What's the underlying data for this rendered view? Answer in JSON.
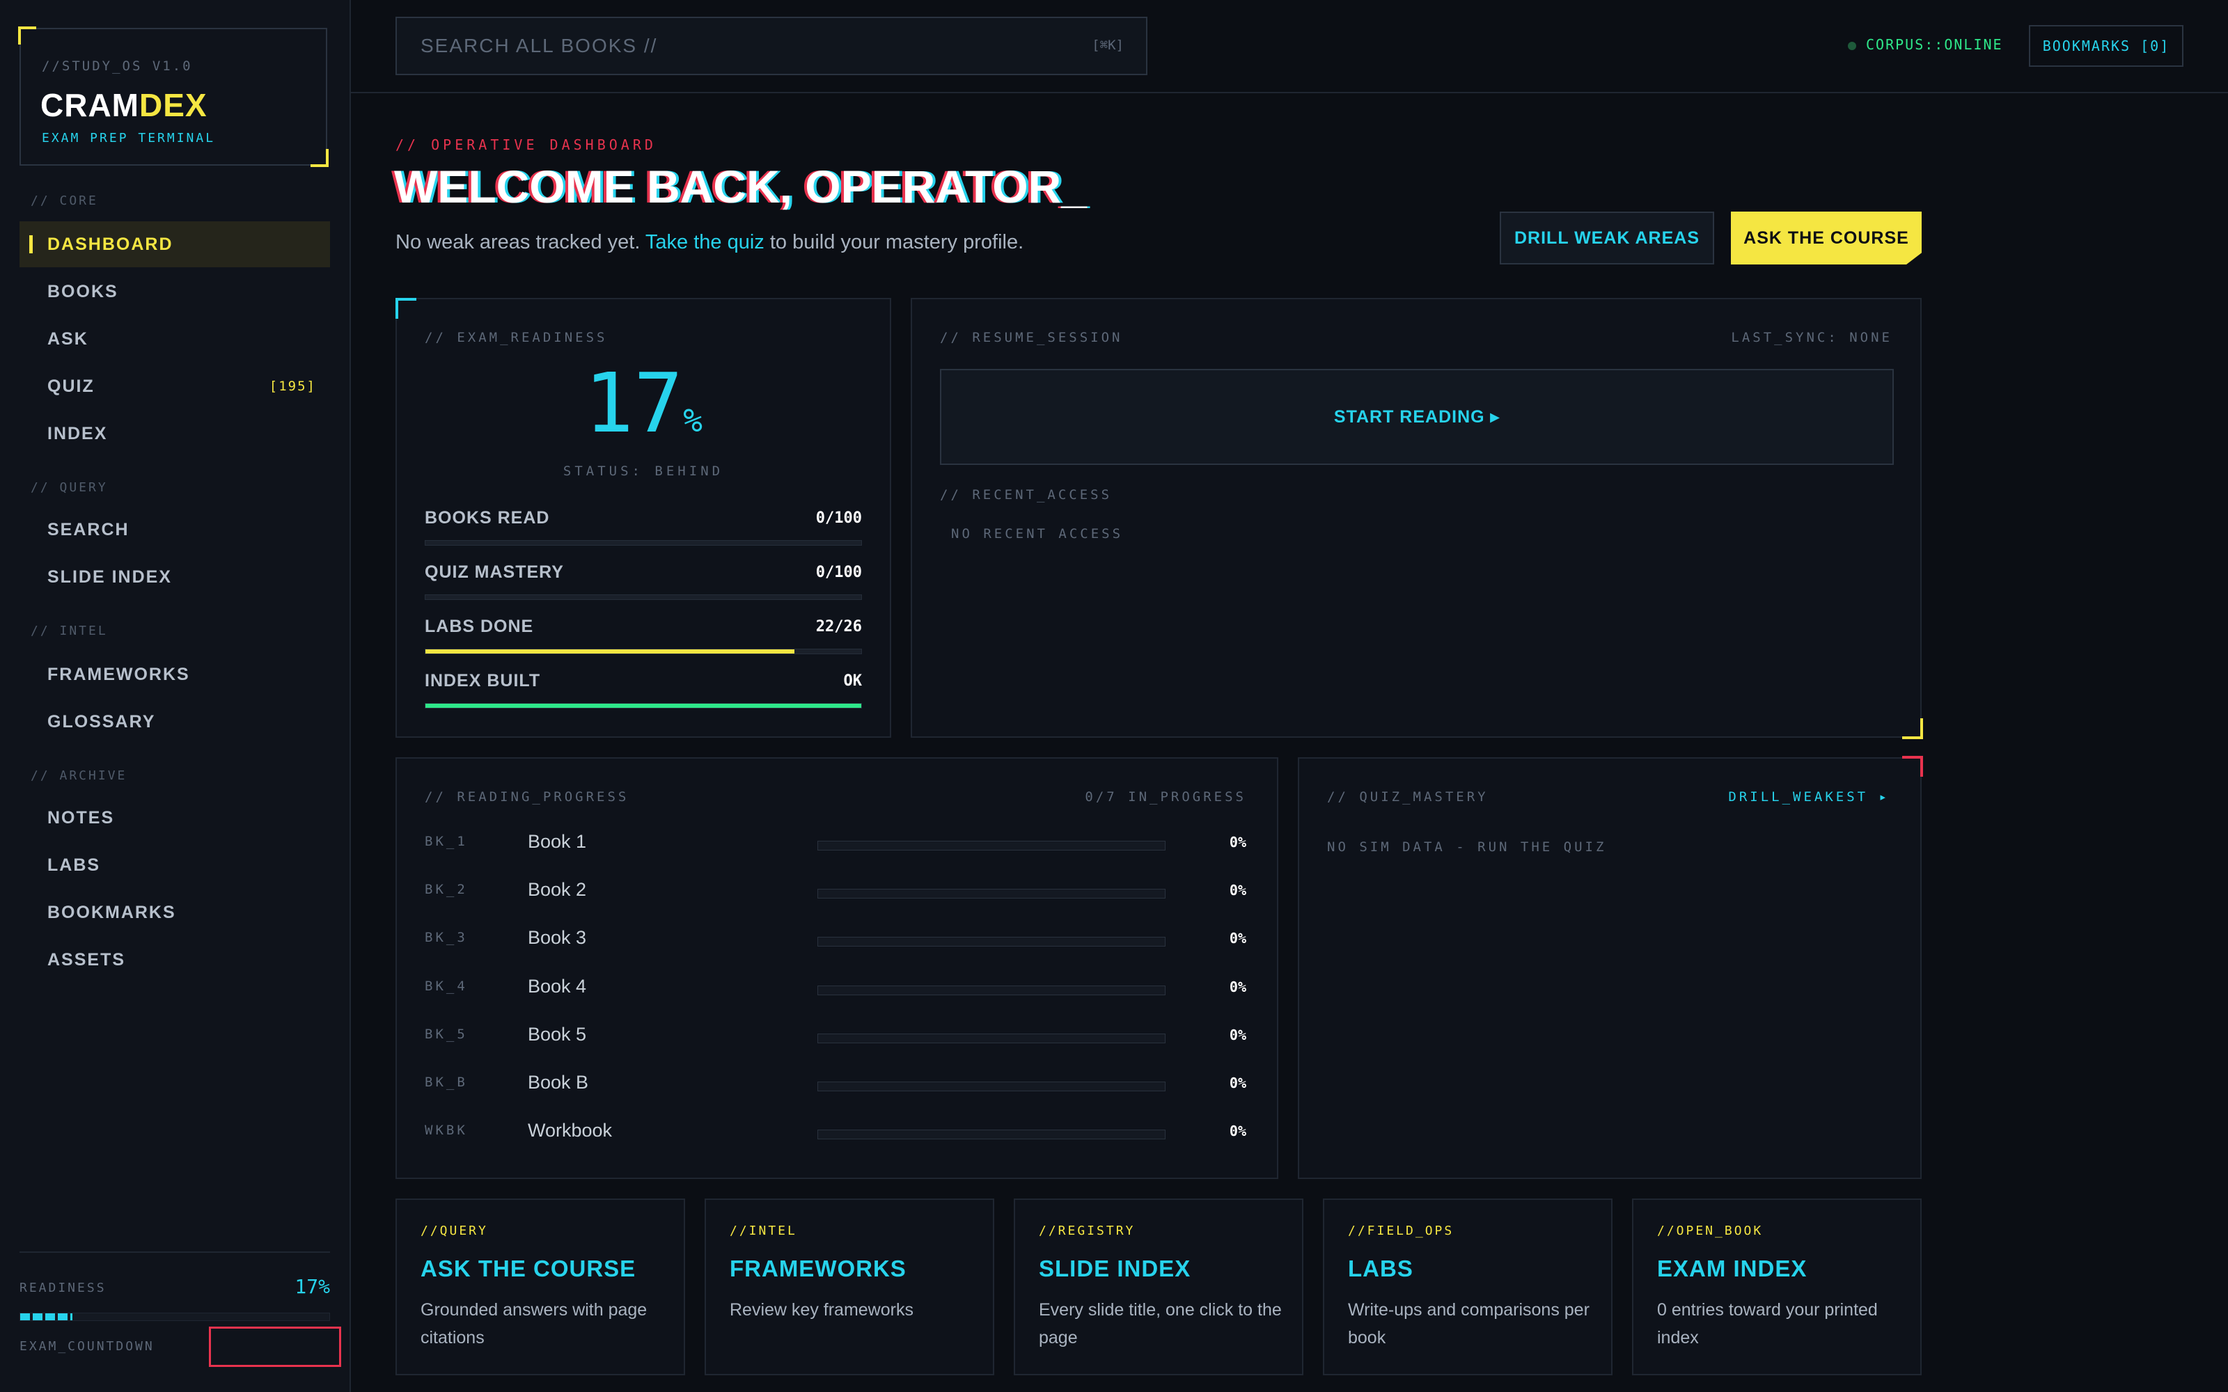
{
  "brand": {
    "version": "//STUDY_OS V1.0",
    "name_a": "CRAM",
    "name_b": "DEX",
    "subtitle": "EXAM PREP TERMINAL"
  },
  "sidebar": {
    "sections": [
      {
        "label": "// CORE"
      },
      {
        "label": "// QUERY"
      },
      {
        "label": "// INTEL"
      },
      {
        "label": "// ARCHIVE"
      }
    ],
    "items": [
      {
        "label": "DASHBOARD"
      },
      {
        "label": "BOOKS"
      },
      {
        "label": "ASK"
      },
      {
        "label": "QUIZ",
        "badge": "[195]"
      },
      {
        "label": "INDEX"
      },
      {
        "label": "SEARCH"
      },
      {
        "label": "SLIDE INDEX"
      },
      {
        "label": "FRAMEWORKS"
      },
      {
        "label": "GLOSSARY"
      },
      {
        "label": "NOTES"
      },
      {
        "label": "LABS"
      },
      {
        "label": "BOOKMARKS"
      },
      {
        "label": "ASSETS"
      }
    ],
    "footer": {
      "readiness_label": "READINESS",
      "readiness_value": "17%",
      "readiness_fraction": 0.17,
      "countdown_label": "EXAM_COUNTDOWN"
    }
  },
  "topbar": {
    "search_placeholder": "SEARCH ALL BOOKS //",
    "search_shortcut": "[⌘K]",
    "status": "CORPUS::ONLINE",
    "bookmarks": "BOOKMARKS [0]"
  },
  "header": {
    "kicker": "// OPERATIVE DASHBOARD",
    "title": "WELCOME BACK, OPERATOR_",
    "sub_pre": "No weak areas tracked yet. ",
    "sub_link": "Take the quiz",
    "sub_post": " to build your mastery profile.",
    "btn_drill": "DRILL WEAK AREAS",
    "btn_ask": "ASK THE COURSE"
  },
  "readiness": {
    "label": "// EXAM_READINESS",
    "value": "17",
    "unit": "%",
    "status": "STATUS: BEHIND",
    "metrics": [
      {
        "label": "BOOKS READ",
        "value": "0/100",
        "fraction": 0,
        "color": "#27d3ec"
      },
      {
        "label": "QUIZ MASTERY",
        "value": "0/100",
        "fraction": 0,
        "color": "#27d3ec"
      },
      {
        "label": "LABS DONE",
        "value": "22/26",
        "fraction": 0.846,
        "color": "#f5e642"
      },
      {
        "label": "INDEX BUILT",
        "value": "OK",
        "fraction": 1,
        "color": "#2ee88a"
      }
    ]
  },
  "resume": {
    "label": "// RESUME_SESSION",
    "last_sync": "LAST_SYNC: NONE",
    "start": "START READING ▸",
    "recent_label": "// RECENT_ACCESS",
    "recent_empty": "NO RECENT ACCESS"
  },
  "reading": {
    "label": "// READING_PROGRESS",
    "summary": "0/7 IN_PROGRESS",
    "books": [
      {
        "code": "BK_1",
        "name": "Book 1",
        "pct": "0%",
        "fraction": 0
      },
      {
        "code": "BK_2",
        "name": "Book 2",
        "pct": "0%",
        "fraction": 0
      },
      {
        "code": "BK_3",
        "name": "Book 3",
        "pct": "0%",
        "fraction": 0
      },
      {
        "code": "BK_4",
        "name": "Book 4",
        "pct": "0%",
        "fraction": 0
      },
      {
        "code": "BK_5",
        "name": "Book 5",
        "pct": "0%",
        "fraction": 0
      },
      {
        "code": "BK_B",
        "name": "Book B",
        "pct": "0%",
        "fraction": 0
      },
      {
        "code": "WKBK",
        "name": "Workbook",
        "pct": "0%",
        "fraction": 0
      }
    ]
  },
  "quiz": {
    "label": "// QUIZ_MASTERY",
    "drill": "DRILL_WEAKEST ▸",
    "empty": "NO SIM DATA - RUN THE QUIZ"
  },
  "cards": [
    {
      "kicker": "//QUERY",
      "title": "ASK THE COURSE",
      "desc": "Grounded answers with page citations"
    },
    {
      "kicker": "//INTEL",
      "title": "FRAMEWORKS",
      "desc": "Review key frameworks"
    },
    {
      "kicker": "//REGISTRY",
      "title": "SLIDE INDEX",
      "desc": "Every slide title, one click to the page"
    },
    {
      "kicker": "//FIELD_OPS",
      "title": "LABS",
      "desc": "Write-ups and comparisons per book"
    },
    {
      "kicker": "//OPEN_BOOK",
      "title": "EXAM INDEX",
      "desc": "0 entries toward your printed index"
    }
  ]
}
